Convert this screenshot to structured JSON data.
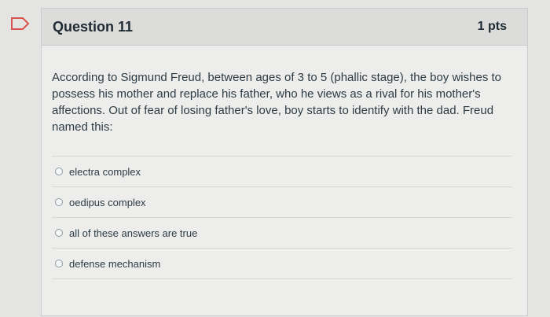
{
  "question": {
    "title": "Question 11",
    "points": "1 pts",
    "text": "According to Sigmund Freud, between ages of 3 to 5 (phallic stage), the boy wishes to possess his mother and replace his father, who he views as a rival for his mother's affections. Out of fear of losing father's love, boy starts to identify with the dad. Freud named this:",
    "answers": [
      {
        "label": "electra complex"
      },
      {
        "label": "oedipus complex"
      },
      {
        "label": "all of these answers are true"
      },
      {
        "label": "defense mechanism"
      }
    ]
  },
  "colors": {
    "flag_accent": "#d9534f",
    "header_bg": "#dcdcda",
    "body_bg": "#ededeb"
  },
  "icons": {
    "flag": "flag-question-icon",
    "radio": "radio-button-icon"
  }
}
